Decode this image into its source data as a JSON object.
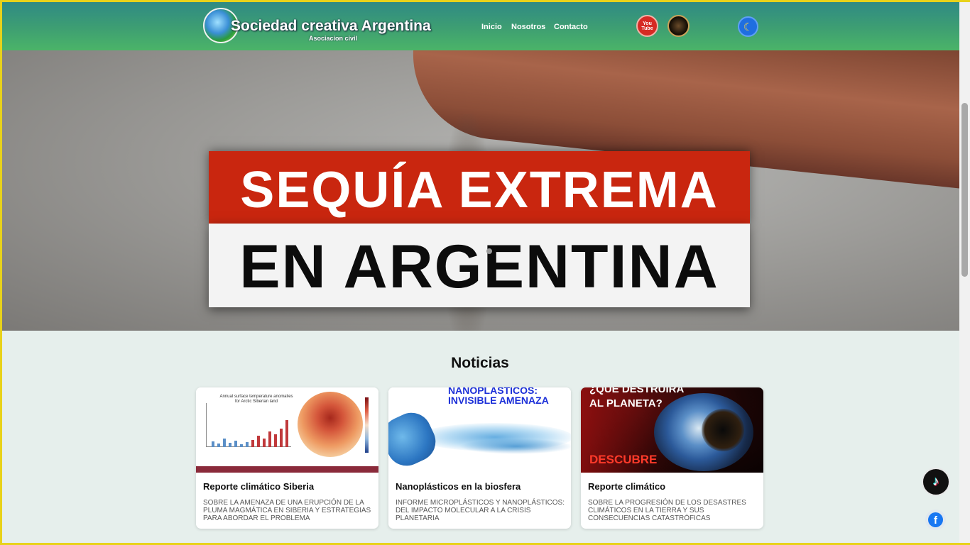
{
  "header": {
    "brand": "Sociedad creativa Argentina",
    "subtitle": "Asociacion civil",
    "nav": [
      "Inicio",
      "Nosotros",
      "Contacto"
    ],
    "youtube_label": "You Tube",
    "theme_icon": "moon-icon"
  },
  "hero": {
    "line1": "SEQUÍA EXTREMA",
    "line2": "EN ARGENTINA"
  },
  "news": {
    "title": "Noticias",
    "cards": [
      {
        "title": "Reporte climático Siberia",
        "description": "SOBRE LA AMENAZA DE UNA ERUPCIÓN DE LA PLUMA MAGMÁTICA EN SIBERIA Y ESTRATEGIAS PARA ABORDAR EL PROBLEMA",
        "image_text": "Annual surface temperature anomalies for Arctic Siberian land"
      },
      {
        "title": "Nanoplásticos en la biosfera",
        "description": "INFORME MICROPLÁSTICOS Y NANOPLÁSTICOS: DEL IMPACTO MOLECULAR A LA CRISIS PLANETARIA",
        "image_text_1": "NANOPLÁSTICOS:",
        "image_text_2": "INVISIBLE AMENAZA"
      },
      {
        "title": "Reporte climático",
        "description": "SOBRE LA PROGRESIÓN DE LOS DESASTRES CLIMÁTICOS EN LA TIERRA Y SUS CONSECUENCIAS CATASTRÓFICAS",
        "image_text_1": "¿QUÉ DESTRUIRÁ",
        "image_text_2": "AL PLANETA?",
        "image_text_3": "DESCUBRE"
      }
    ]
  },
  "social": {
    "tiktok_icon": "tiktok-icon",
    "facebook_icon": "facebook-icon"
  },
  "colors": {
    "header_gradient_top": "#2f8a84",
    "header_gradient_bottom": "#4bb468",
    "hero_red": "#c9260f",
    "page_bg": "#e6efec"
  }
}
